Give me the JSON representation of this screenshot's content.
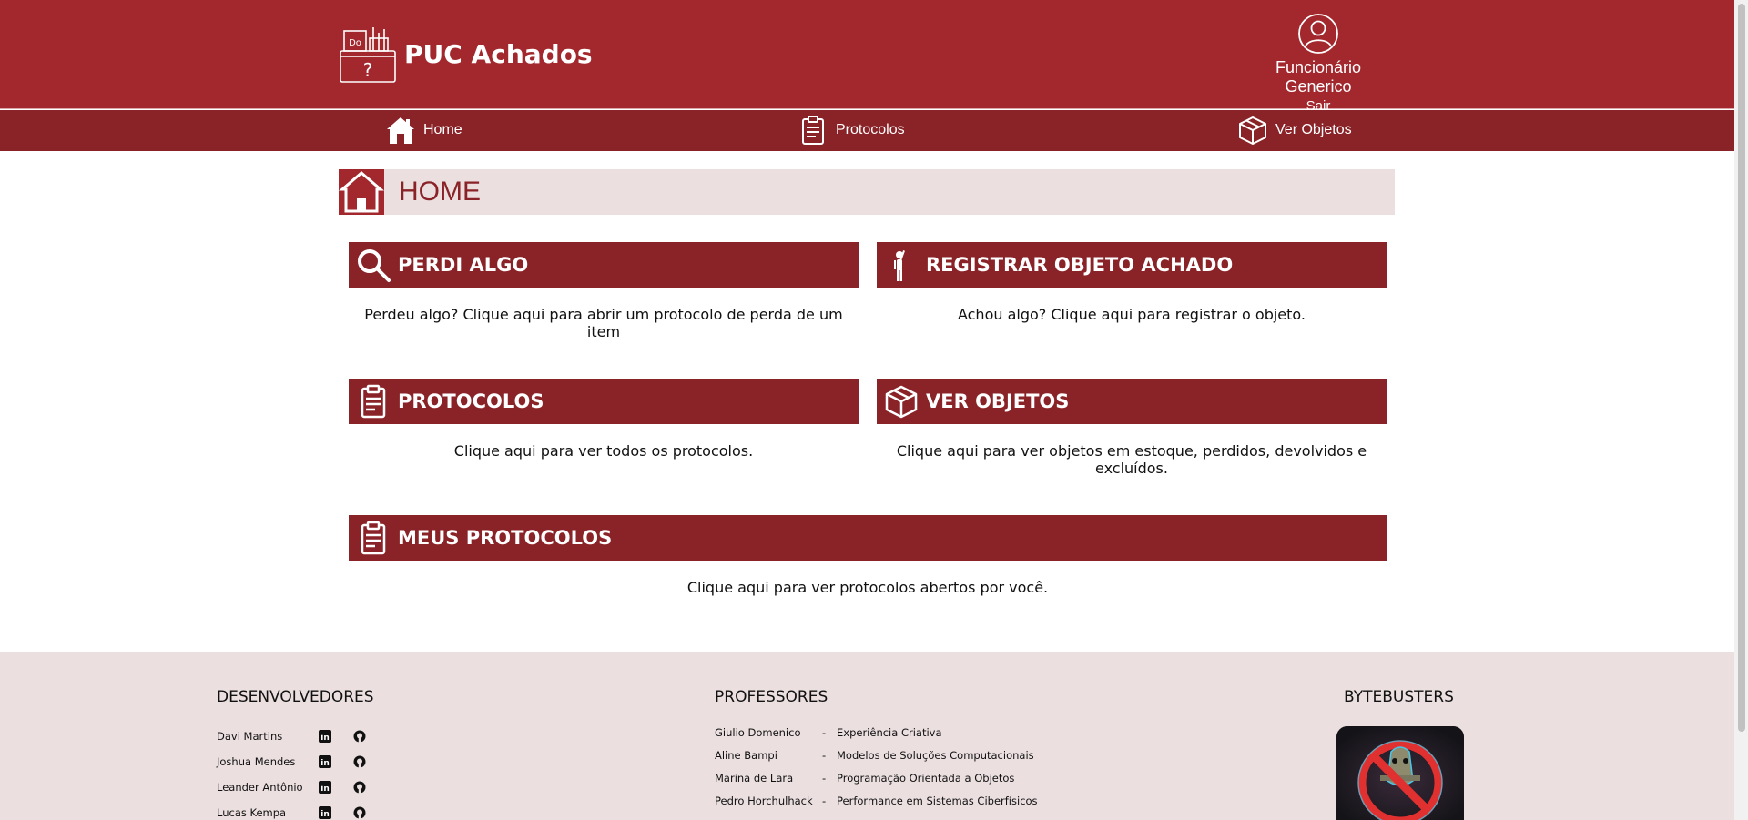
{
  "header": {
    "app_title": "PUC Achados",
    "user_name": "Funcionário Generico",
    "logout_label": "Sair"
  },
  "nav": {
    "items": [
      {
        "label": "Home",
        "icon": "home-icon"
      },
      {
        "label": "Protocolos",
        "icon": "clipboard-icon"
      },
      {
        "label": "Ver Objetos",
        "icon": "box-icon"
      }
    ]
  },
  "page": {
    "title": "HOME"
  },
  "cards": [
    {
      "title": "PERDI ALGO",
      "description": "Perdeu algo? Clique aqui para abrir um protocolo de perda de um item",
      "icon": "search-icon"
    },
    {
      "title": "REGISTRAR OBJETO ACHADO",
      "description": "Achou algo? Clique aqui para registrar o objeto.",
      "icon": "person-pointing-icon"
    },
    {
      "title": "PROTOCOLOS",
      "description": "Clique aqui para ver todos os protocolos.",
      "icon": "clipboard-icon"
    },
    {
      "title": "VER OBJETOS",
      "description": "Clique aqui para ver objetos em estoque, perdidos, devolvidos e excluídos.",
      "icon": "box-icon"
    },
    {
      "title": "MEUS PROTOCOLOS",
      "description": "Clique aqui para ver protocolos abertos por você.",
      "icon": "clipboard-icon"
    }
  ],
  "footer": {
    "developers_heading": "DESENVOLVEDORES",
    "developers": [
      "Davi Martins",
      "Joshua Mendes",
      "Leander Antônio",
      "Lucas Kempa"
    ],
    "professors_heading": "PROFESSORES",
    "professors": [
      {
        "name": "Giulio Domenico",
        "separator": "-",
        "subject": "Experiência Criativa"
      },
      {
        "name": "Aline Bampi",
        "separator": "-",
        "subject": "Modelos de Soluções Computacionais"
      },
      {
        "name": "Marina de Lara",
        "separator": "-",
        "subject": "Programação Orientada a Objetos"
      },
      {
        "name": "Pedro Horchulhack",
        "separator": "-",
        "subject": "Performance em Sistemas Ciberfísicos"
      }
    ],
    "team_heading": "BYTEBUSTERS"
  },
  "colors": {
    "brand": "#a2282e",
    "brand_dark": "#8a2328",
    "light_bg": "#ebdfe0"
  }
}
